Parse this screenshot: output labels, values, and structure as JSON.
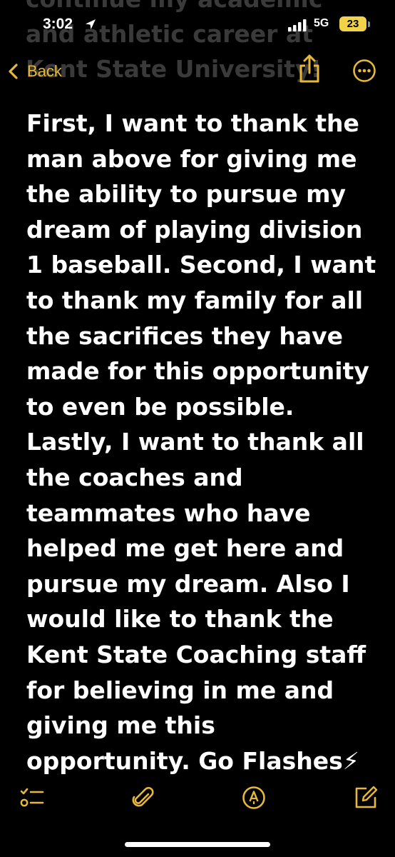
{
  "status_bar": {
    "time": "3:02",
    "network": "5G",
    "battery": "23"
  },
  "nav": {
    "back_label": "Back",
    "share_icon": "share-icon",
    "more_icon": "ellipsis-circle-icon"
  },
  "ghost_lines": [
    "continue my academic",
    "and athletic career at",
    "Kent State University!"
  ],
  "note": {
    "lines": [
      "First, I want to thank the",
      "man above for giving me",
      "the ability to pursue my",
      "dream of playing division",
      "1 baseball. Second, I want",
      "to thank my family for all",
      "the sacrifices they have",
      "made for this opportunity",
      "to even be possible.",
      "Lastly, I want to thank all",
      "the coaches and",
      "teammates who have",
      "helped me get here and",
      "pursue my dream. Also I",
      "would like to thank the",
      "Kent State Coaching staff",
      "for believing in me and",
      "giving me this",
      "opportunity. Go Flashes⚡"
    ]
  },
  "toolbar": {
    "items": [
      "checklist-icon",
      "paperclip-icon",
      "markup-pen-icon",
      "compose-icon"
    ]
  },
  "colors": {
    "accent": "#e5b83a",
    "background": "#000000",
    "battery": "#f1d34a"
  }
}
